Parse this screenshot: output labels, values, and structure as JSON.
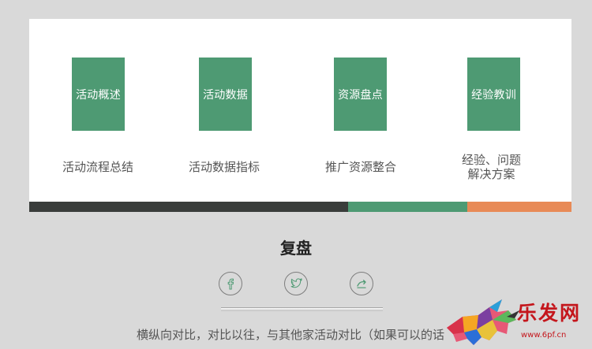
{
  "steps": [
    {
      "label": "活动概述",
      "caption": "活动流程总结"
    },
    {
      "label": "活动数据",
      "caption": "活动数据指标"
    },
    {
      "label": "资源盘点",
      "caption": "推广资源整合"
    },
    {
      "label": "经验教训",
      "caption_line1": "经验、问题",
      "caption_line2": "解决方案"
    }
  ],
  "title": "复盘",
  "social_icons": [
    "facebook-icon",
    "twitter-icon",
    "share-icon"
  ],
  "bottom_text": "横纵向对比，对比以往，与其他家活动对比（如果可以的话",
  "watermark": {
    "name": "乐发网",
    "url": "www.6pf.cn"
  },
  "colors": {
    "green": "#4e9a73",
    "dark": "#3a3d3b",
    "orange": "#e88a56",
    "brand_red": "#c4161c"
  }
}
